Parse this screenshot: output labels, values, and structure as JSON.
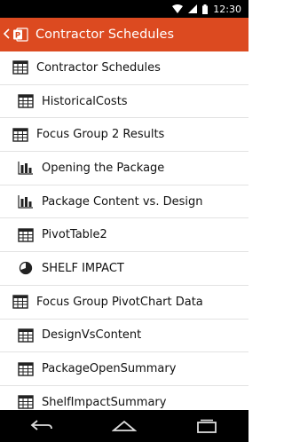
{
  "status_bar": {
    "time": "12:30"
  },
  "app_bar": {
    "title": "Contractor Schedules",
    "accent": "#dc4a20"
  },
  "items": [
    {
      "label": "Contractor Schedules",
      "icon": "table-icon",
      "level": 0
    },
    {
      "label": "HistoricalCosts",
      "icon": "table-icon",
      "level": 1
    },
    {
      "label": "Focus Group 2 Results",
      "icon": "table-icon",
      "level": 0
    },
    {
      "label": "Opening the Package",
      "icon": "bar-chart-icon",
      "level": 1
    },
    {
      "label": "Package Content vs. Design",
      "icon": "bar-chart-icon",
      "level": 1
    },
    {
      "label": "PivotTable2",
      "icon": "table-icon",
      "level": 1
    },
    {
      "label": "SHELF IMPACT",
      "icon": "pie-chart-icon",
      "level": 1
    },
    {
      "label": "Focus Group PivotChart Data",
      "icon": "table-icon",
      "level": 0
    },
    {
      "label": "DesignVsContent",
      "icon": "table-icon",
      "level": 1
    },
    {
      "label": "PackageOpenSummary",
      "icon": "table-icon",
      "level": 1
    },
    {
      "label": "ShelfImpactSummary",
      "icon": "table-icon",
      "level": 1
    }
  ]
}
